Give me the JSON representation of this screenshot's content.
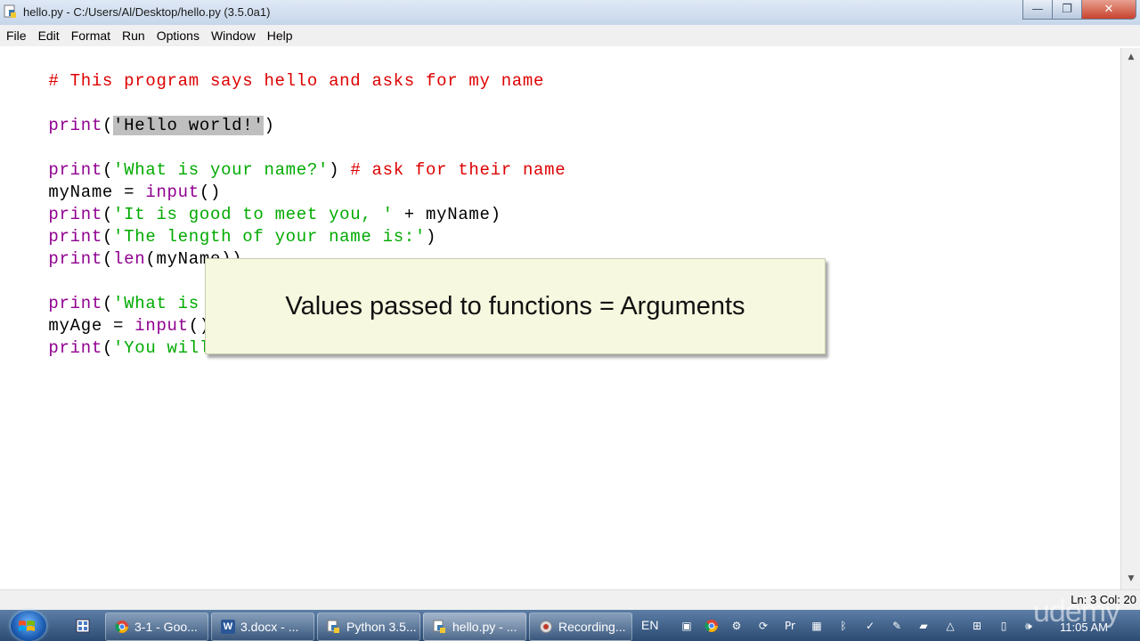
{
  "window": {
    "title": "hello.py - C:/Users/Al/Desktop/hello.py (3.5.0a1)",
    "minimize_glyph": "—",
    "maximize_glyph": "❐",
    "close_glyph": "✕"
  },
  "menu": [
    "File",
    "Edit",
    "Format",
    "Run",
    "Options",
    "Window",
    "Help"
  ],
  "code": {
    "line1": "# This program says hello and asks for my name",
    "line3": {
      "fn": "print",
      "open": "(",
      "selected": "'Hello world!'",
      "close": ")"
    },
    "line5": {
      "fn": "print",
      "open": "(",
      "str": "'What is your name?'",
      "close": ") ",
      "comment": "# ask for their name"
    },
    "line6": {
      "pre": "myName = ",
      "fn": "input",
      "post": "()"
    },
    "line7": {
      "fn": "print",
      "open": "(",
      "str": "'It is good to meet you, '",
      "post": " + myName)"
    },
    "line8": {
      "fn": "print",
      "open": "(",
      "str": "'The length of your name is:'",
      "close": ")"
    },
    "line9": {
      "fn": "print",
      "open": "(",
      "fn2": "len",
      "post": "(myName))"
    },
    "line11": {
      "fn": "print",
      "open": "(",
      "str": "'What is y"
    },
    "line12": {
      "pre": "myAge = ",
      "fn": "input",
      "post": "()"
    },
    "line13": {
      "fn": "print",
      "open": "(",
      "str": "'You will"
    }
  },
  "callout": {
    "text": "Values passed to functions = Arguments"
  },
  "status": {
    "position": "Ln: 3 Col: 20"
  },
  "taskbar": {
    "tasks": [
      {
        "label": "3-1 - Goo...",
        "icon": "chrome-icon"
      },
      {
        "label": "3.docx - ...",
        "icon": "word-icon"
      },
      {
        "label": "Python 3.5...",
        "icon": "python-icon"
      },
      {
        "label": "hello.py - ...",
        "icon": "python-icon"
      },
      {
        "label": "Recording...",
        "icon": "recorder-icon"
      }
    ],
    "language": "EN",
    "clock": "11:05 AM"
  },
  "watermark": "udemy",
  "colors": {
    "keyword": "#900090",
    "string": "#00aa00",
    "comment": "#dd0000",
    "selection": "#bfbfbf"
  }
}
